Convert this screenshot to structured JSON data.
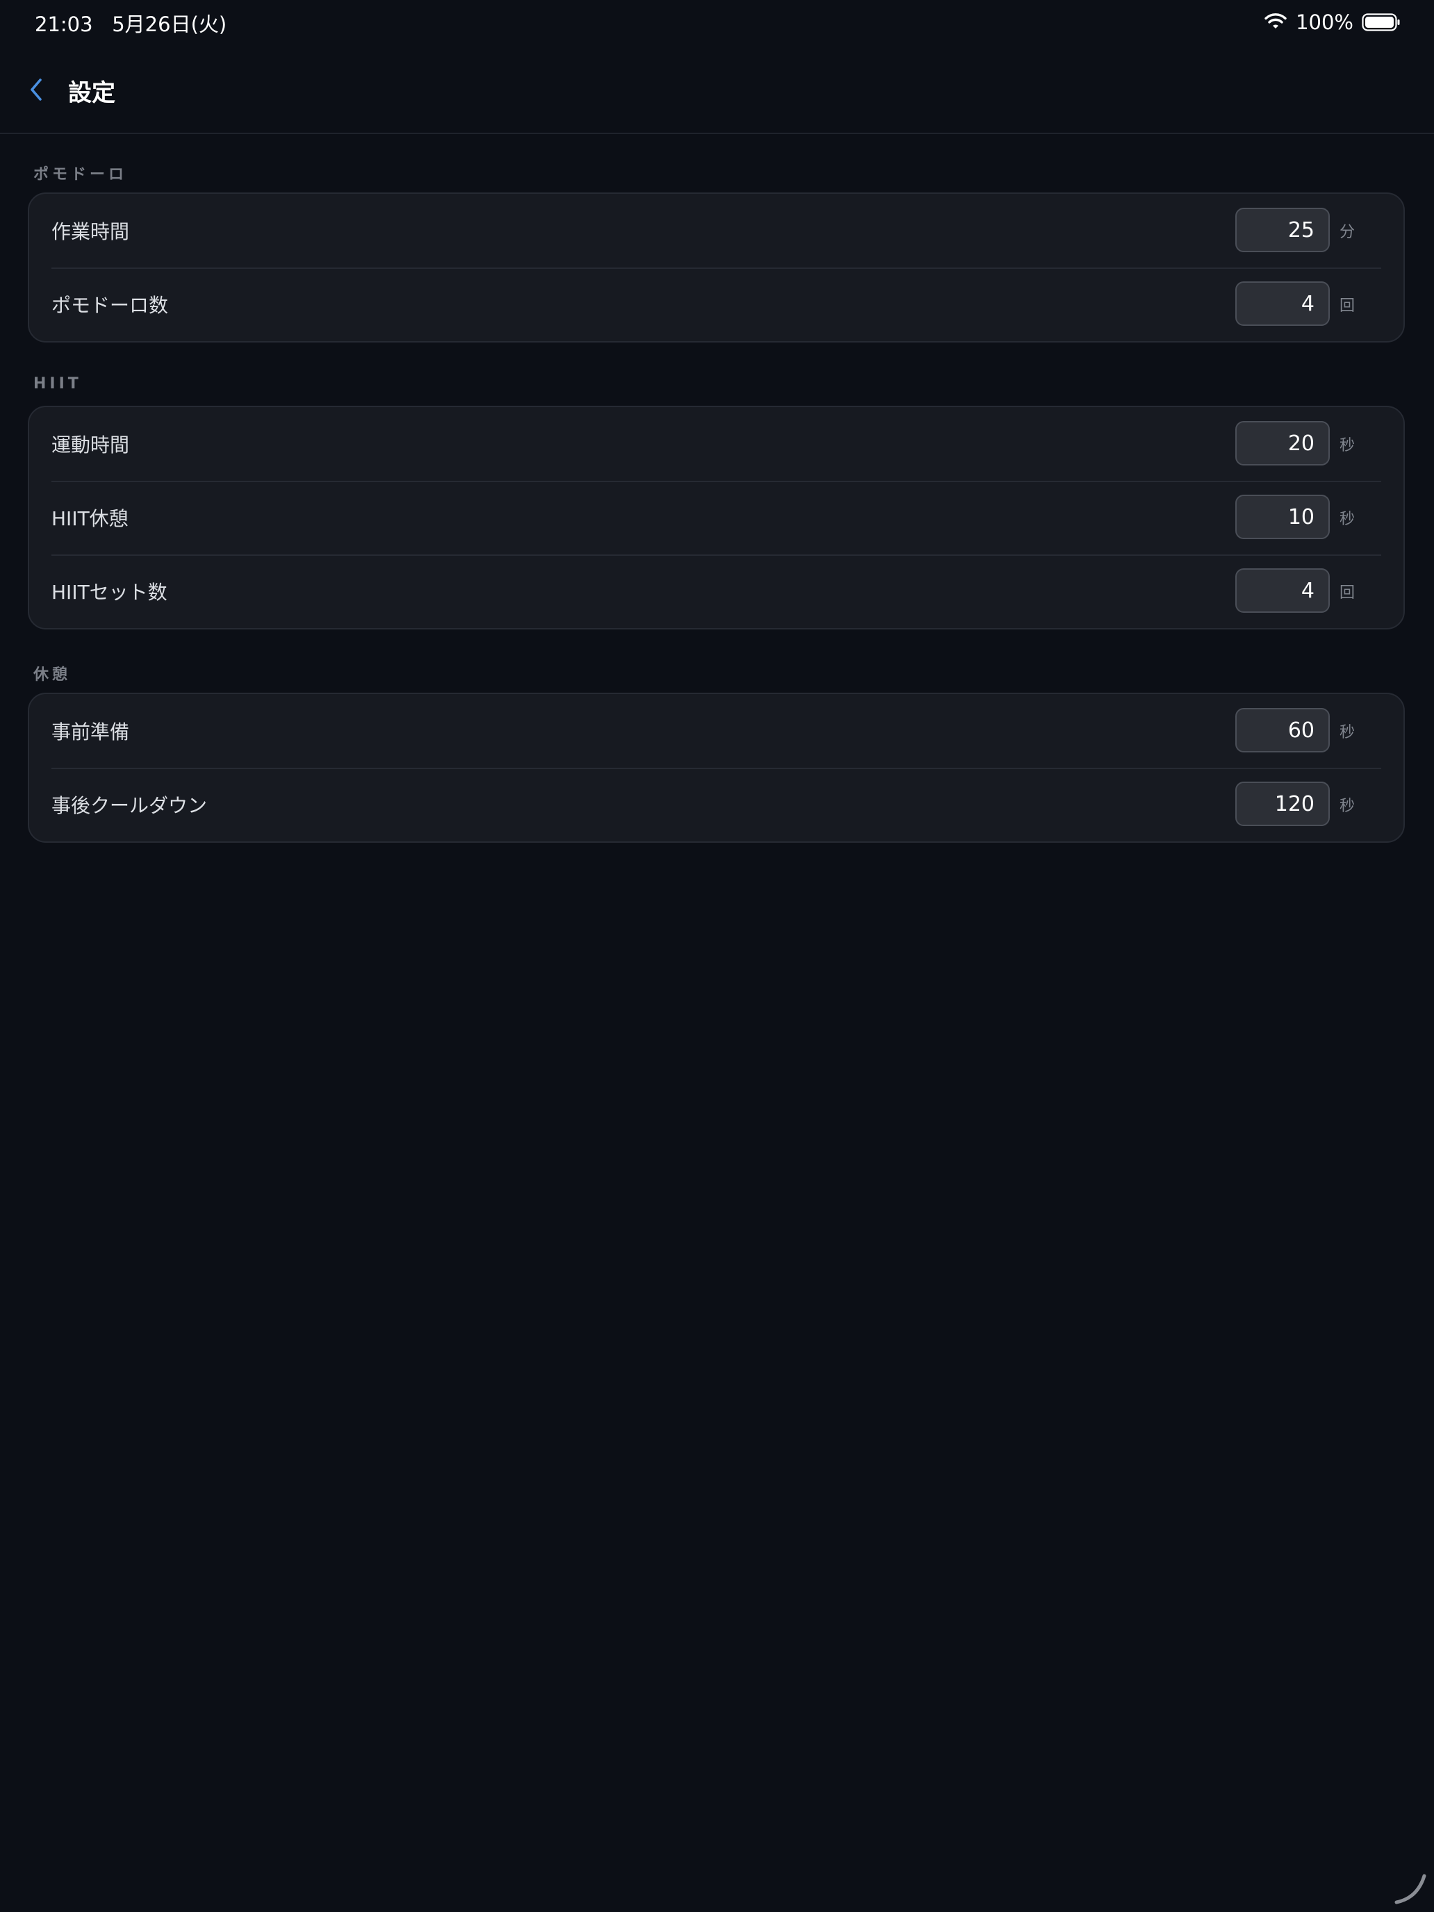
{
  "status_bar": {
    "time": "21:03   5月26日(火)",
    "battery": "100%"
  },
  "nav": {
    "title": "設定"
  },
  "sections": [
    {
      "header": "ポモドーロ",
      "rows": [
        {
          "label": "作業時間",
          "value": "25",
          "unit": "分"
        },
        {
          "label": "ポモドーロ数",
          "value": "4",
          "unit": "回"
        }
      ]
    },
    {
      "header": "HIIT",
      "rows": [
        {
          "label": "運動時間",
          "value": "20",
          "unit": "秒"
        },
        {
          "label": "HIIT休憩",
          "value": "10",
          "unit": "秒"
        },
        {
          "label": "HIITセット数",
          "value": "4",
          "unit": "回"
        }
      ]
    },
    {
      "header": "休憩",
      "rows": [
        {
          "label": "事前準備",
          "value": "60",
          "unit": "秒"
        },
        {
          "label": "事後クールダウン",
          "value": "120",
          "unit": "秒"
        }
      ]
    }
  ],
  "colors": {
    "background": "#0c0f16",
    "card": "#171a21",
    "accent": "#4a90e2"
  }
}
